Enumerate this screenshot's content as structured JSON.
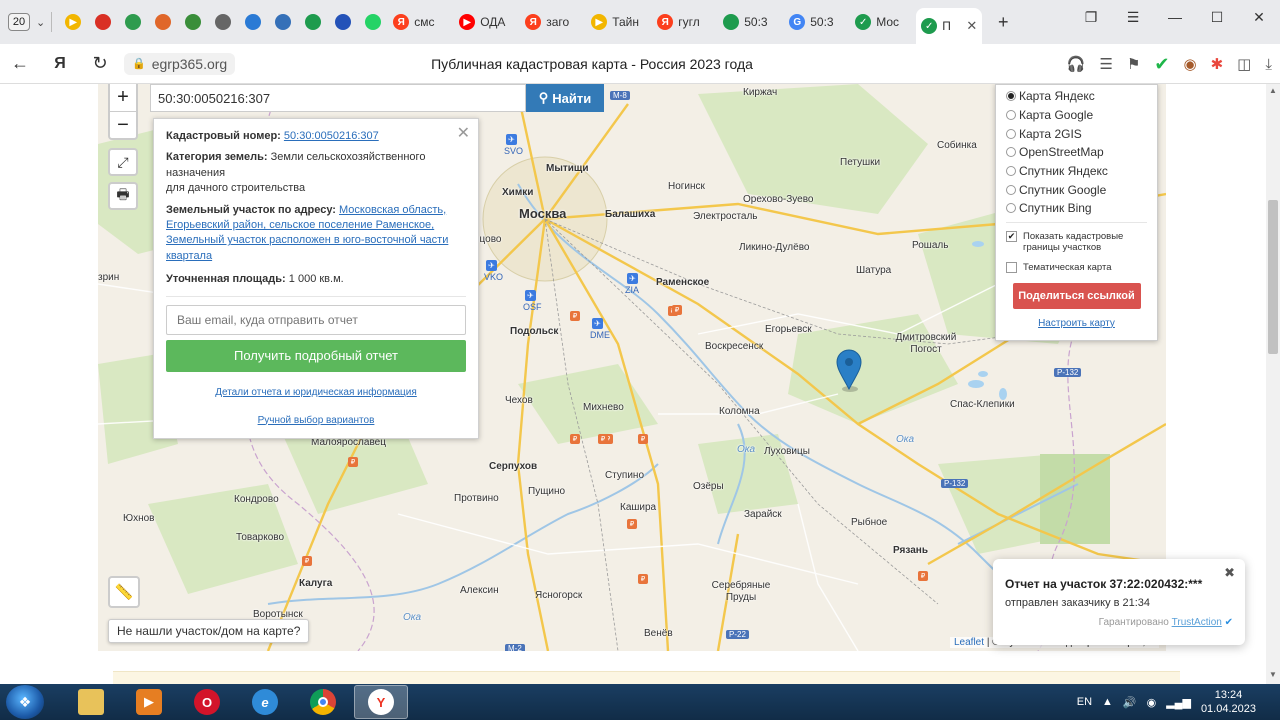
{
  "browser": {
    "tab_count": "20",
    "tabs": [
      {
        "icon": "play-icon",
        "color": "#f2b600",
        "label": ""
      },
      {
        "icon": "gmail-icon",
        "color": "#d93025",
        "label": ""
      },
      {
        "icon": "cube-icon",
        "color": "#2e9b4e",
        "label": ""
      },
      {
        "icon": "gauge-icon",
        "color": "#e0672a",
        "label": ""
      },
      {
        "icon": "arrows-icon",
        "color": "#3a8e3a",
        "label": ""
      },
      {
        "icon": "document-icon",
        "color": "#666666",
        "label": ""
      },
      {
        "icon": "refresh-icon",
        "color": "#2a7ad5",
        "label": ""
      },
      {
        "icon": "compass-icon",
        "color": "#3570b8",
        "label": ""
      },
      {
        "icon": "map-pin-icon",
        "color": "#1e9b4e",
        "label": ""
      },
      {
        "icon": "flag-icon",
        "color": "#2452b8",
        "label": ""
      },
      {
        "icon": "whatsapp-icon",
        "color": "#25d366",
        "label": ""
      },
      {
        "icon": "yandex-icon",
        "color": "#fc3f1d",
        "label": "смс"
      },
      {
        "icon": "youtube-icon",
        "color": "#ff0000",
        "label": "ОДА"
      },
      {
        "icon": "yandex-icon",
        "color": "#fc3f1d",
        "label": "заго"
      },
      {
        "icon": "play-icon",
        "color": "#f2b600",
        "label": "Тайн"
      },
      {
        "icon": "yandex-icon",
        "color": "#fc3f1d",
        "label": "гугл"
      },
      {
        "icon": "map-pin-icon",
        "color": "#1e9b4e",
        "label": "50:3"
      },
      {
        "icon": "google-icon",
        "color": "#4285f4",
        "label": "50:3"
      },
      {
        "icon": "check-icon",
        "color": "#1e9b4e",
        "label": "Моc"
      },
      {
        "icon": "check-icon",
        "color": "#1e9b4e",
        "label": "П"
      }
    ],
    "domain": "egrp365.org",
    "page_title": "Публичная кадастровая карта - Россия 2023 года"
  },
  "search": {
    "value": "50:30:0050216:307",
    "button_label": "Найти"
  },
  "info": {
    "cad_label": "Кадастровый номер:",
    "cad_value": "50:30:0050216:307",
    "cat_label": "Категория земель:",
    "cat_value": "Земли сельскохозяйственного назначения",
    "cat_value2": "для дачного строительства",
    "addr_label": "Земельный участок по адресу:",
    "addr_value": "Московская область, Егорьевский район, сельское поселение Раменское, Земельный участок расположен в юго-восточной части квартала",
    "area_label": "Уточненная площадь:",
    "area_value": "1 000 кв.м.",
    "email_placeholder": "Ваш email, куда отправить отчет",
    "report_button": "Получить подробный отчет",
    "details_link": "Детали отчета и юридическая информация",
    "manual_link": "Ручной выбор вариантов"
  },
  "layers": {
    "options": [
      {
        "label": "Карта Яндекс",
        "selected": true
      },
      {
        "label": "Карта Google",
        "selected": false
      },
      {
        "label": "Карта 2GIS",
        "selected": false
      },
      {
        "label": "OpenStreetMap",
        "selected": false
      },
      {
        "label": "Спутник Яндекс",
        "selected": false
      },
      {
        "label": "Спутник Google",
        "selected": false
      },
      {
        "label": "Спутник Bing",
        "selected": false
      }
    ],
    "show_borders": "Показать кадастровые границы участков",
    "thematic": "Тематическая карта",
    "share_button": "Поделиться ссылкой",
    "config_link": "Настроить карту"
  },
  "map": {
    "cities": [
      {
        "name": "Москва",
        "big": true
      },
      {
        "name": "Мытищи",
        "bold": true
      },
      {
        "name": "Химки",
        "bold": true
      },
      {
        "name": "Балашиха",
        "bold": true
      },
      {
        "name": "Подольск",
        "bold": true
      },
      {
        "name": "Раменское",
        "bold": true
      },
      {
        "name": "Ногинск"
      },
      {
        "name": "Электросталь"
      },
      {
        "name": "Орехово-Зуево"
      },
      {
        "name": "Ликино-Дулёво"
      },
      {
        "name": "Киржач"
      },
      {
        "name": "Петушки"
      },
      {
        "name": "Собинка"
      },
      {
        "name": "Рошаль"
      },
      {
        "name": "Шатура"
      },
      {
        "name": "Егорьевск"
      },
      {
        "name": "Дмитровский Погост"
      },
      {
        "name": "Воскресенск"
      },
      {
        "name": "Коломна"
      },
      {
        "name": "Спас-Клепики"
      },
      {
        "name": "Луховицы"
      },
      {
        "name": "Чехов"
      },
      {
        "name": "Михнево"
      },
      {
        "name": "Серпухов",
        "bold": true
      },
      {
        "name": "Ступино"
      },
      {
        "name": "Озёры"
      },
      {
        "name": "Пущино"
      },
      {
        "name": "Протвино"
      },
      {
        "name": "Кашира"
      },
      {
        "name": "Зарайск"
      },
      {
        "name": "Рыбное"
      },
      {
        "name": "Рязань",
        "bold": true
      },
      {
        "name": "Кондрово"
      },
      {
        "name": "Юхнов"
      },
      {
        "name": "Товарково"
      },
      {
        "name": "Калуга",
        "bold": true
      },
      {
        "name": "Алексин"
      },
      {
        "name": "Ясногорск"
      },
      {
        "name": "Серебряные Пруды"
      },
      {
        "name": "Венёв"
      },
      {
        "name": "Малоярославец"
      },
      {
        "name": "Воротынск"
      },
      {
        "name": "Ока"
      },
      {
        "name": "Ока"
      },
      {
        "name": "Ока"
      },
      {
        "name": "зрин"
      },
      {
        "name": "нцово"
      }
    ],
    "roads": [
      "М-8",
      "Р-132",
      "Р-132",
      "Р-22",
      "М-2"
    ],
    "airports": [
      "SVO",
      "VKO",
      "OSF",
      "DME",
      "ZIA"
    ],
    "ruler_tooltip": "",
    "not_found_button": "Не нашли участок/дом на карте?",
    "attribution_link": "Leaflet",
    "attribution_text": "| © Публичная кадастровая карта, ©"
  },
  "notification": {
    "title": "Отчет на участок 37:22:020432:***",
    "subtitle": "отправлен заказчику в 21:34",
    "guarantee": "Гарантировано",
    "guarantee_brand": "TrustAction"
  },
  "taskbar": {
    "lang": "EN",
    "time": "13:24",
    "date": "01.04.2023"
  }
}
